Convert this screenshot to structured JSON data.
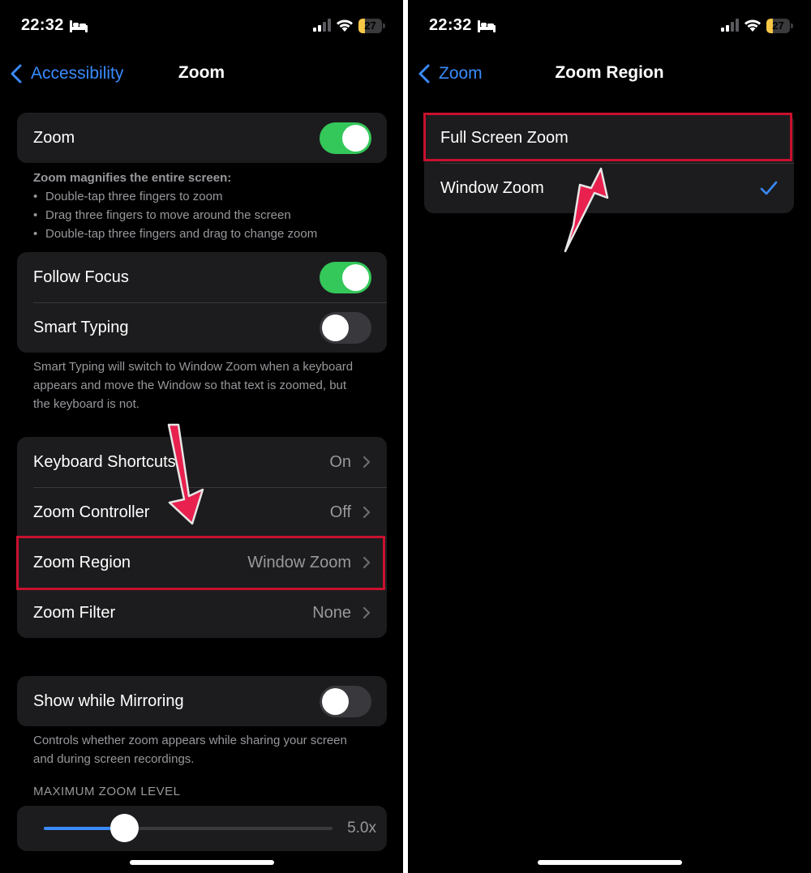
{
  "status_bar": {
    "time": "22:32",
    "battery": "27",
    "battery_level": 0.27
  },
  "left": {
    "nav": {
      "back_label": "Accessibility",
      "title": "Zoom"
    },
    "zoom_row": {
      "label": "Zoom",
      "toggle_on": true
    },
    "zoom_note": {
      "heading": "Zoom magnifies the entire screen:",
      "bullets": [
        "Double-tap three fingers to zoom",
        "Drag three fingers to move around the screen",
        "Double-tap three fingers and drag to change zoom"
      ]
    },
    "follow_focus": {
      "label": "Follow Focus",
      "toggle_on": true
    },
    "smart_typing": {
      "label": "Smart Typing",
      "toggle_on": false
    },
    "smart_typing_note": "Smart Typing will switch to Window Zoom when a keyboard appears and move the Window so that text is zoomed, but the keyboard is not.",
    "settings": [
      {
        "label": "Keyboard Shortcuts",
        "value": "On"
      },
      {
        "label": "Zoom Controller",
        "value": "Off"
      },
      {
        "label": "Zoom Region",
        "value": "Window Zoom"
      },
      {
        "label": "Zoom Filter",
        "value": "None"
      }
    ],
    "mirroring": {
      "label": "Show while Mirroring",
      "toggle_on": false
    },
    "mirroring_note": "Controls whether zoom appears while sharing your screen and during screen recordings.",
    "max_zoom": {
      "header": "MAXIMUM ZOOM LEVEL",
      "value_label": "5.0x",
      "level_fraction": 0.28
    }
  },
  "right": {
    "nav": {
      "back_label": "Zoom",
      "title": "Zoom Region"
    },
    "options": [
      {
        "label": "Full Screen Zoom",
        "selected": false
      },
      {
        "label": "Window Zoom",
        "selected": true
      }
    ]
  },
  "colors": {
    "accent": "#3a8bfd",
    "toggle_on": "#34c759",
    "highlight": "#c8102e",
    "arrow": "#e8214f",
    "battery": "#f6c744"
  },
  "icons": [
    "bed-icon",
    "signal-icon",
    "wifi-icon",
    "battery-icon",
    "chevron-left-icon",
    "chevron-right-icon",
    "checkmark-icon",
    "arrow-annotation-icon"
  ]
}
